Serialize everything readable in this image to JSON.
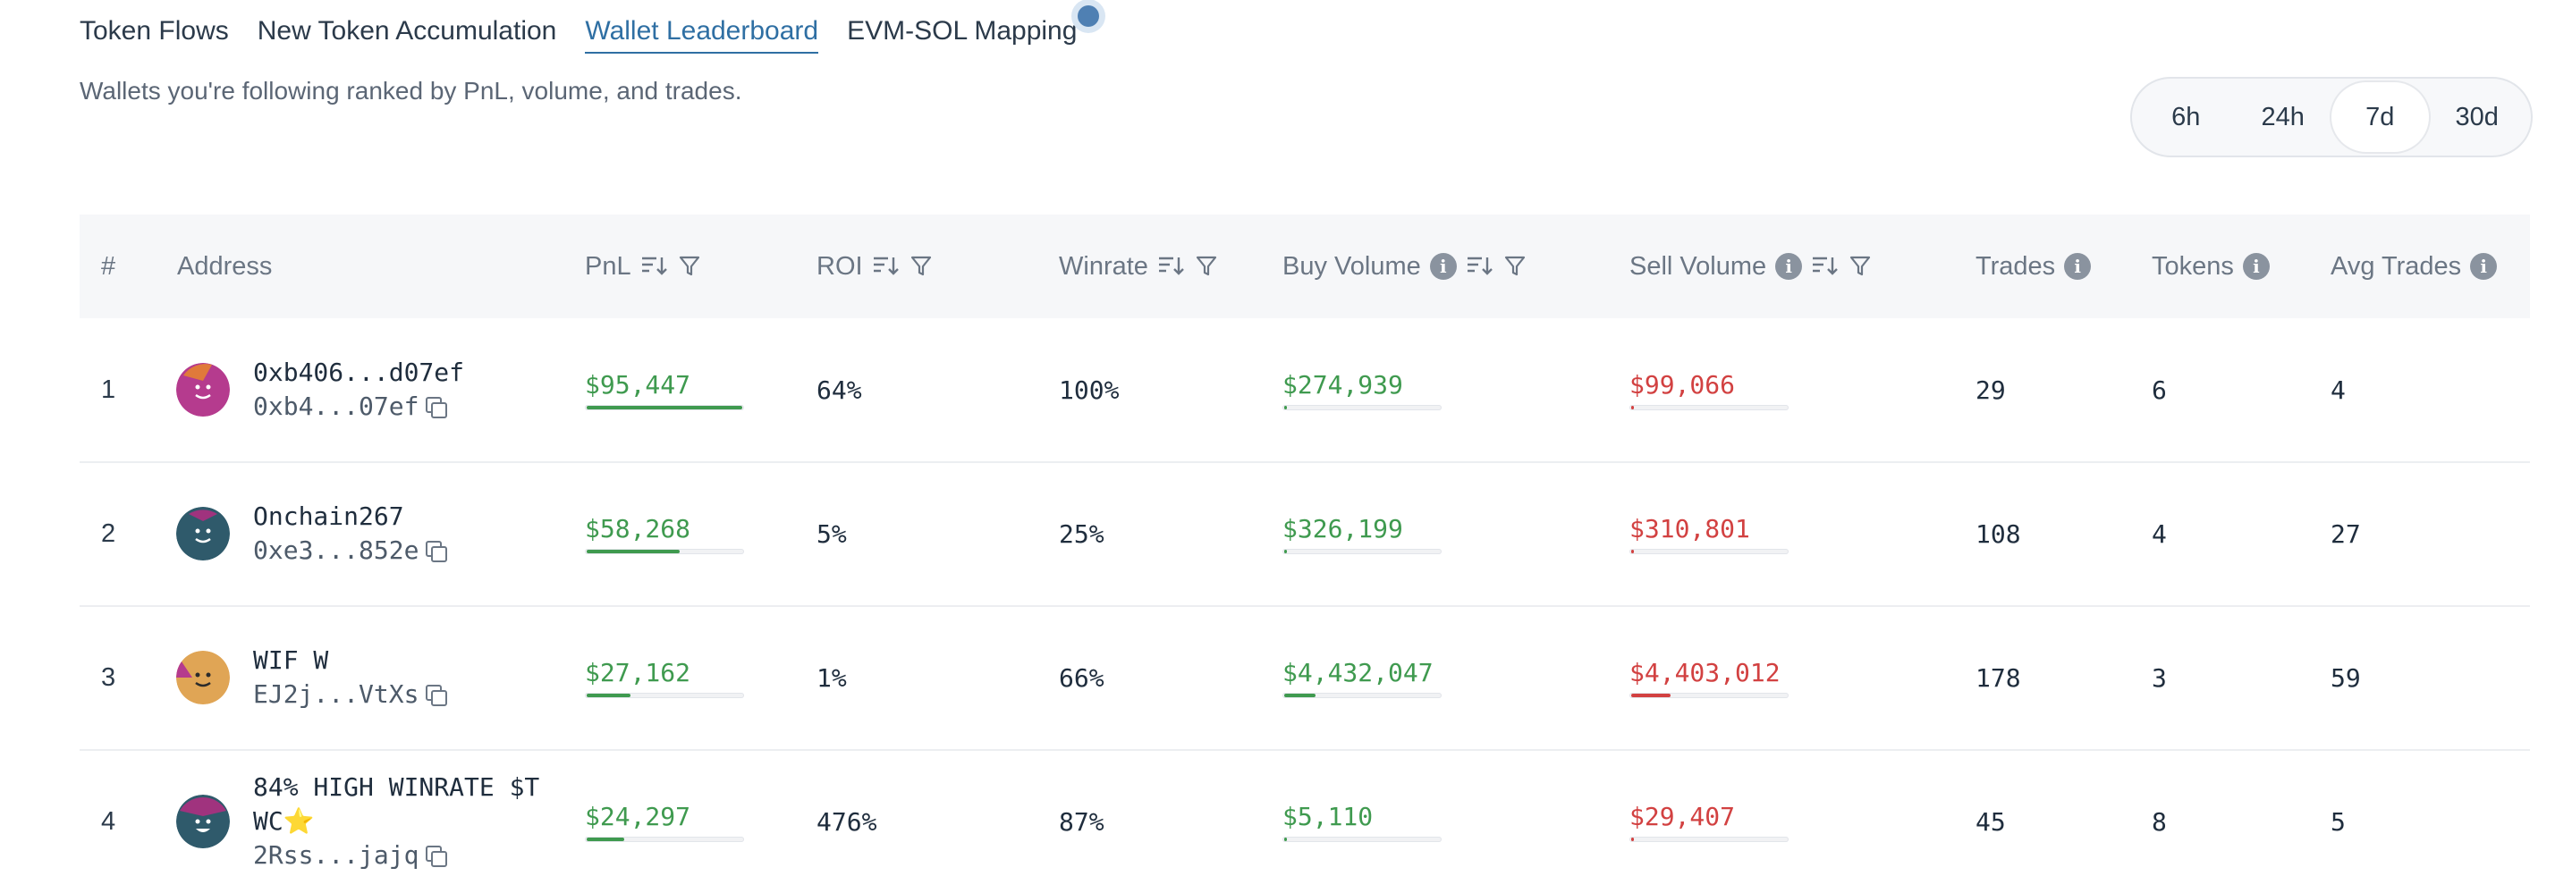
{
  "tabs": [
    "Token Flows",
    "New Token Accumulation",
    "Wallet Leaderboard",
    "EVM-SOL Mapping"
  ],
  "active_tab": 2,
  "subtitle": "Wallets you're following ranked by PnL, volume, and trades.",
  "timeframes": [
    "6h",
    "24h",
    "7d",
    "30d"
  ],
  "active_timeframe": 2,
  "columns": {
    "rank": "#",
    "address": "Address",
    "pnl": "PnL",
    "roi": "ROI",
    "winrate": "Winrate",
    "buy_volume": "Buy Volume",
    "sell_volume": "Sell Volume",
    "trades": "Trades",
    "tokens": "Tokens",
    "avg_trades": "Avg Trades"
  },
  "colors": {
    "green": "#3f9a4f",
    "red": "#d24141",
    "accent": "#2f6fa3"
  },
  "rows": [
    {
      "rank": "1",
      "name": "0xb406...d07ef",
      "address": "0xb4...07ef",
      "avatar": "magenta-face",
      "pnl": "$95,447",
      "pnl_fraction": 1.0,
      "roi": "64%",
      "winrate": "100%",
      "buy_volume": "$274,939",
      "buy_fraction": 0.01,
      "sell_volume": "$99,066",
      "sell_fraction": 0.01,
      "trades": "29",
      "tokens": "6",
      "avg_trades": "4"
    },
    {
      "rank": "2",
      "name": "Onchain267",
      "address": "0xe3...852e",
      "avatar": "teal-face",
      "pnl": "$58,268",
      "pnl_fraction": 0.6,
      "roi": "5%",
      "winrate": "25%",
      "buy_volume": "$326,199",
      "buy_fraction": 0.01,
      "sell_volume": "$310,801",
      "sell_fraction": 0.01,
      "trades": "108",
      "tokens": "4",
      "avg_trades": "27"
    },
    {
      "rank": "3",
      "name": "WIF W",
      "address": "EJ2j...VtXs",
      "avatar": "orange-face",
      "pnl": "$27,162",
      "pnl_fraction": 0.28,
      "roi": "1%",
      "winrate": "66%",
      "buy_volume": "$4,432,047",
      "buy_fraction": 0.2,
      "sell_volume": "$4,403,012",
      "sell_fraction": 0.25,
      "trades": "178",
      "tokens": "3",
      "avg_trades": "59"
    },
    {
      "rank": "4",
      "name_line1": "84% HIGH WINRATE $T",
      "name_line2": "WC⭐",
      "address": "2Rss...jajq",
      "avatar": "purple-teal-face",
      "pnl": "$24,297",
      "pnl_fraction": 0.24,
      "roi": "476%",
      "winrate": "87%",
      "buy_volume": "$5,110",
      "buy_fraction": 0.01,
      "sell_volume": "$29,407",
      "sell_fraction": 0.01,
      "trades": "45",
      "tokens": "8",
      "avg_trades": "5"
    }
  ]
}
